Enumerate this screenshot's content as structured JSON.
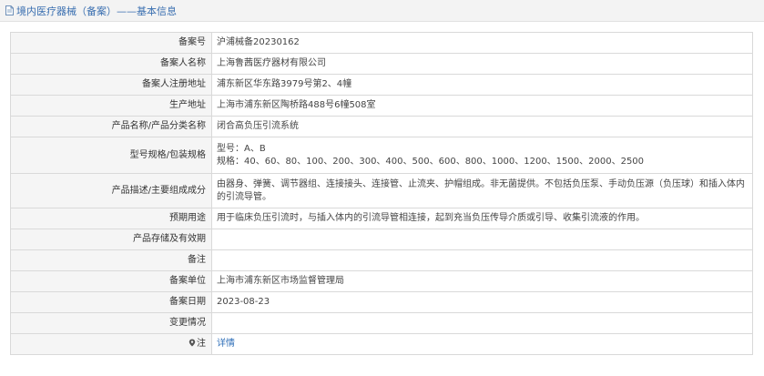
{
  "header": {
    "title": "境内医疗器械（备案）——基本信息"
  },
  "rows": [
    {
      "label": "备案号",
      "value": "沪浦械备20230162"
    },
    {
      "label": "备案人名称",
      "value": "上海鲁茜医疗器材有限公司"
    },
    {
      "label": "备案人注册地址",
      "value": "浦东新区华东路3979号第2、4幢"
    },
    {
      "label": "生产地址",
      "value": "上海市浦东新区陶桥路488号6幢508室"
    },
    {
      "label": "产品名称/产品分类名称",
      "value": "闭合高负压引流系统"
    },
    {
      "label": "型号规格/包装规格",
      "value_lines": [
        "型号：A、B",
        "规格：40、60、80、100、200、300、400、500、600、800、1000、1200、1500、2000、2500"
      ]
    },
    {
      "label": "产品描述/主要组成成分",
      "value": "由器身、弹簧、调节器组、连接接头、连接管、止流夹、护帽组成。非无菌提供。不包括负压泵、手动负压源（负压球）和插入体内的引流导管。"
    },
    {
      "label": "预期用途",
      "value": "用于临床负压引流时，与插入体内的引流导管相连接，起到充当负压传导介质或引导、收集引流液的作用。"
    },
    {
      "label": "产品存储及有效期",
      "value": ""
    },
    {
      "label": "备注",
      "value": ""
    },
    {
      "label": "备案单位",
      "value": "上海市浦东新区市场监督管理局"
    },
    {
      "label": "备案日期",
      "value": "2023-08-23"
    },
    {
      "label": "变更情况",
      "value": ""
    },
    {
      "label": "注",
      "value": "详情"
    }
  ]
}
